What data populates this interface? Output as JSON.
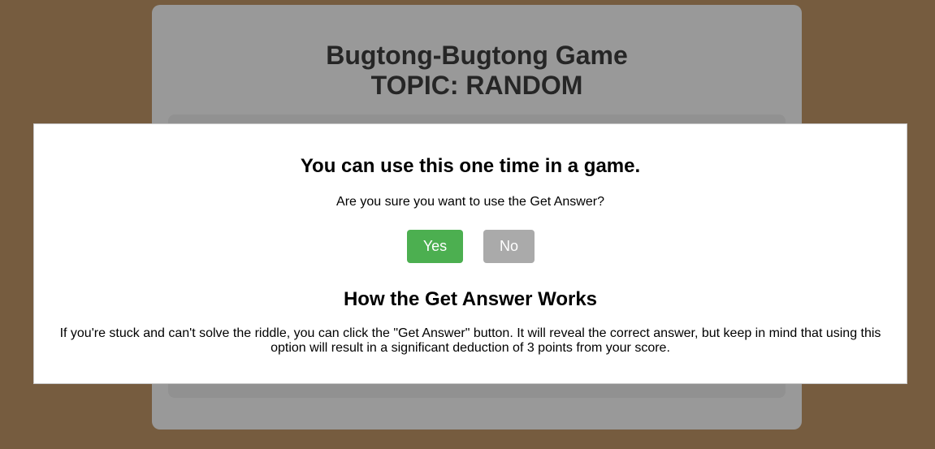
{
  "game": {
    "title_line1": "Bugtong-Bugtong Game",
    "title_line2": "TOPIC: RANDOM"
  },
  "modal": {
    "heading": "You can use this one time in a game.",
    "question": "Are you sure you want to use the Get Answer?",
    "yes_label": "Yes",
    "no_label": "No",
    "how_heading": "How the Get Answer Works",
    "how_text": "If you're stuck and can't solve the riddle, you can click the \"Get Answer\" button. It will reveal the correct answer, but keep in mind that using this option will result in a significant deduction of 3 points from your score."
  },
  "colors": {
    "page_background": "#765c3f",
    "card_background": "#999999",
    "yes_button": "#4caf50",
    "no_button": "#aaaaaa",
    "modal_background": "#ffffff"
  }
}
